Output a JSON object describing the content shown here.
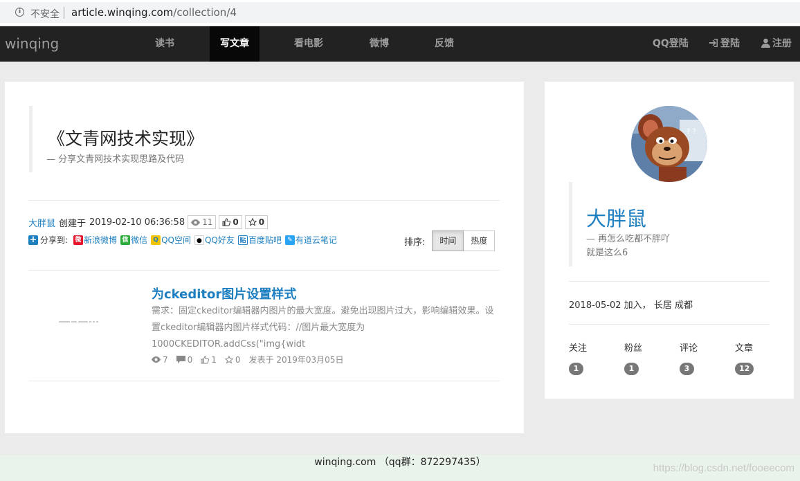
{
  "browser": {
    "security_label": "不安全",
    "url_host": "article.winqing.com",
    "url_path": "/collection/4"
  },
  "nav": {
    "brand": "winqing",
    "items": [
      "读书",
      "写文章",
      "看电影",
      "微博",
      "反馈"
    ],
    "active_index": 1,
    "right": {
      "qq_login": "QQ登陆",
      "login": "登陆",
      "register": "注册"
    }
  },
  "collection": {
    "title": "《文青网技术实现》",
    "desc": "— 分享文青网技术实现思路及代码",
    "author": "大胖鼠",
    "created_label": "创建于",
    "created_at": "2019-02-10 06:36:58",
    "views": "11",
    "likes": "0",
    "stars": "0"
  },
  "share": {
    "label": "分享到:",
    "targets": [
      "新浪微博",
      "微信",
      "QQ空间",
      "QQ好友",
      "百度贴吧",
      "有道云笔记"
    ]
  },
  "sort": {
    "label": "排序:",
    "options": [
      "时间",
      "热度"
    ],
    "active_index": 0
  },
  "article": {
    "title": "为ckeditor图片设置样式",
    "excerpt": "需求：固定ckeditor编辑器内图片的最大宽度。避免出现图片过大，影响编辑效果。设置ckeditor编辑器内图片样式代码：//图片最大宽度为1000CKEDITOR.addCss(\"img{widt",
    "views": "7",
    "comments": "0",
    "likes": "1",
    "stars": "0",
    "published": "发表于 2019年03月05日"
  },
  "profile": {
    "name": "大胖鼠",
    "motto_line1": "— 再怎么吃都不胖吖",
    "motto_line2": "就是这么6",
    "joined": "2018-05-02 加入，  长居 成都",
    "stats": [
      {
        "label": "关注",
        "value": "1"
      },
      {
        "label": "粉丝",
        "value": "1"
      },
      {
        "label": "评论",
        "value": "3"
      },
      {
        "label": "文章",
        "value": "12"
      }
    ]
  },
  "footer": {
    "text": "winqing.com （qq群：872297435）"
  },
  "watermark": "https://blog.csdn.net/fooeecom",
  "colors": {
    "link": "#1e7fc0",
    "navbar": "#222222",
    "navbar_active": "#080808",
    "footer_bg": "#eaf3ea"
  }
}
